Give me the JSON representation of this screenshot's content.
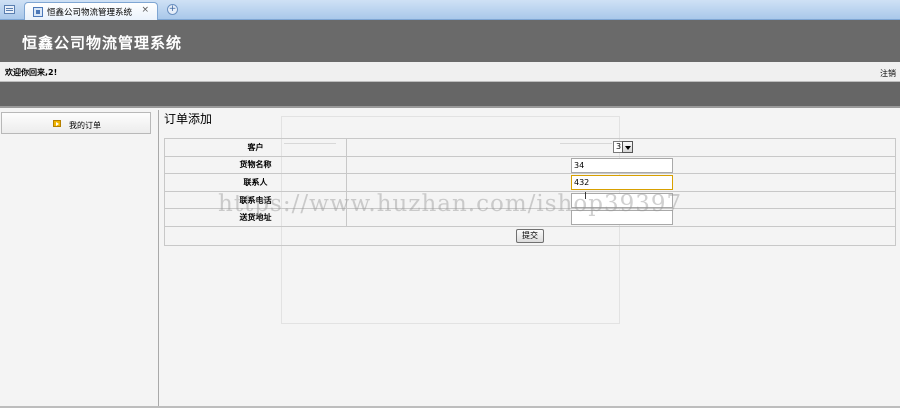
{
  "browser": {
    "tab_title": "恒鑫公司物流管理系统",
    "tab_close": "×",
    "new_tab": "+"
  },
  "header": {
    "app_title": "恒鑫公司物流管理系统",
    "welcome": "欢迎你回来,2!",
    "logout": "注销"
  },
  "sidebar": {
    "items": [
      {
        "label": "我的订单",
        "icon": "arrow-icon"
      }
    ]
  },
  "main": {
    "page_title": "订单添加",
    "form": {
      "customer_label": "客户",
      "customer_selected": "3",
      "goods_name_label": "货物名称",
      "goods_name_value": "34",
      "contact_label": "联系人",
      "contact_value": "432",
      "phone_label": "联系电话",
      "phone_value": "",
      "address_label": "送货地址",
      "address_value": "",
      "submit_label": "提交"
    }
  },
  "watermark": "https://www.huzhan.com/ishop39397",
  "colors": {
    "header_bg": "#6a6a6a",
    "focus_border": "#d8a000"
  }
}
